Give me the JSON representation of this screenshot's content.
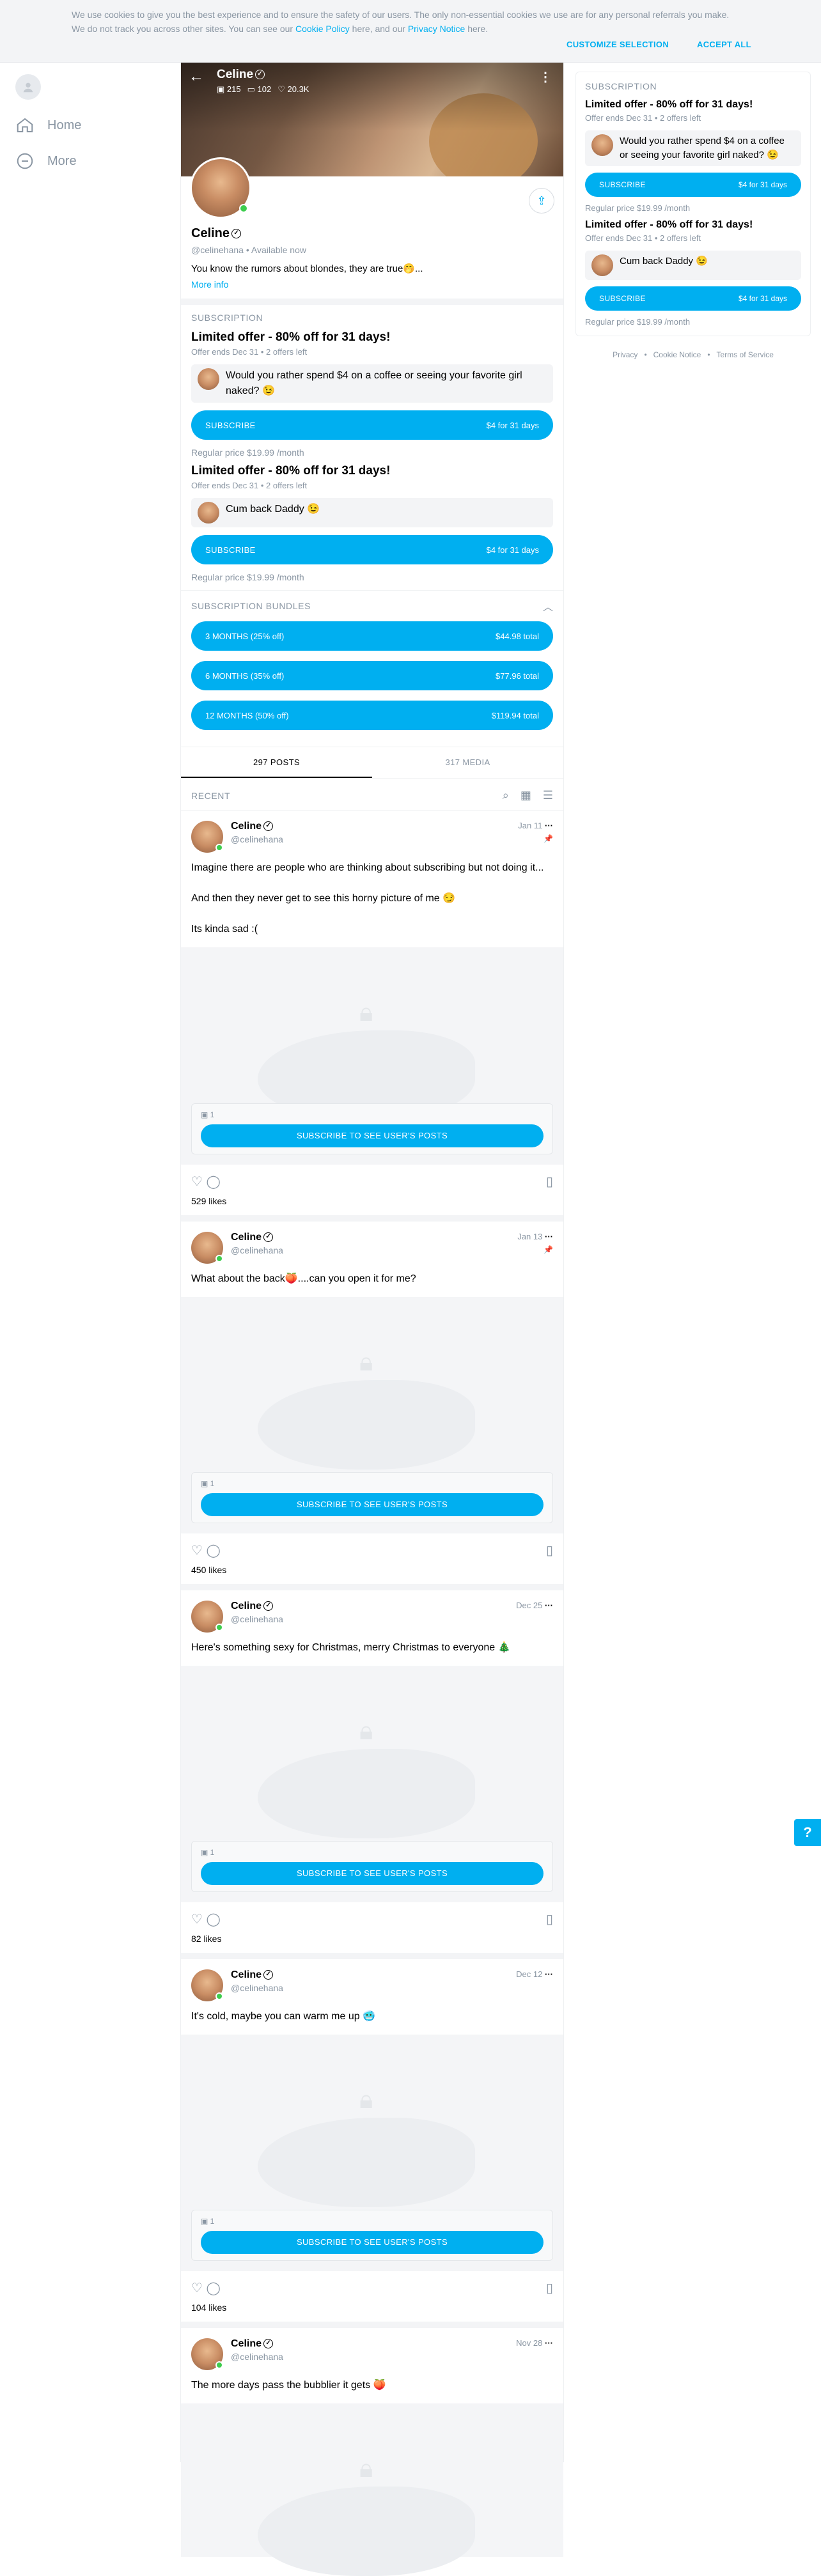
{
  "cookie": {
    "text_a": "We use cookies to give you the best experience and to ensure the safety of our users. The only non-essential cookies we use are for any personal referrals you make. We do not track you across other sites. You can see our ",
    "policy_link": "Cookie Policy",
    "text_b": " here, and our ",
    "privacy_link": "Privacy Notice",
    "text_c": " here.",
    "customize": "CUSTOMIZE SELECTION",
    "accept": "ACCEPT ALL"
  },
  "nav": {
    "home": "Home",
    "more": "More"
  },
  "profile": {
    "name": "Celine",
    "stats_photos": "215",
    "stats_videos": "102",
    "stats_likes": "20.3K",
    "handle": "@celinehana",
    "status": "Available now",
    "bio": "You know the rumors about blondes, they are true🤭...",
    "more_info": "More info"
  },
  "subscription": {
    "title": "SUBSCRIPTION",
    "offers": [
      {
        "title": "Limited offer - 80% off for 31 days!",
        "meta": "Offer ends Dec 31  •  2 offers left",
        "message": "Would you rather spend $4 on a coffee or seeing your favorite girl naked? 😉",
        "button_left": "SUBSCRIBE",
        "button_right": "$4 for 31 days",
        "regular": "Regular price $19.99 /month"
      },
      {
        "title": "Limited offer - 80% off for 31 days!",
        "meta": "Offer ends Dec 31  •  2 offers left",
        "message": "Cum back Daddy 😉",
        "button_left": "SUBSCRIBE",
        "button_right": "$4 for 31 days",
        "regular": "Regular price $19.99 /month"
      }
    ]
  },
  "bundles": {
    "title": "SUBSCRIPTION BUNDLES",
    "items": [
      {
        "label": "3 MONTHS (25% off)",
        "price": "$44.98 total"
      },
      {
        "label": "6 MONTHS (35% off)",
        "price": "$77.96 total"
      },
      {
        "label": "12 MONTHS (50% off)",
        "price": "$119.94 total"
      }
    ]
  },
  "tabs": {
    "posts": "297 POSTS",
    "media": "317 MEDIA"
  },
  "recent": "RECENT",
  "posts": [
    {
      "name": "Celine",
      "handle": "@celinehana",
      "date": "Jan 11",
      "text": "Imagine there are people who are thinking about subscribing but not doing it...\n\nAnd then they never get to see this horny picture of me 😏\n\nIts kinda sad :(",
      "media_count": "1",
      "cta": "SUBSCRIBE TO SEE USER'S POSTS",
      "likes": "529 likes"
    },
    {
      "name": "Celine",
      "handle": "@celinehana",
      "date": "Jan 13",
      "text": "What about the back🍑....can you open it for me?",
      "media_count": "1",
      "cta": "SUBSCRIBE TO SEE USER'S POSTS",
      "likes": "450 likes"
    },
    {
      "name": "Celine",
      "handle": "@celinehana",
      "date": "Dec 25",
      "text": "Here's something sexy for Christmas, merry Christmas to everyone 🎄",
      "media_count": "1",
      "cta": "SUBSCRIBE TO SEE USER'S POSTS",
      "likes": "82 likes"
    },
    {
      "name": "Celine",
      "handle": "@celinehana",
      "date": "Dec 12",
      "text": "It's cold, maybe you can warm me up 🥶",
      "media_count": "1",
      "cta": "SUBSCRIBE TO SEE USER'S POSTS",
      "likes": "104 likes"
    },
    {
      "name": "Celine",
      "handle": "@celinehana",
      "date": "Nov 28",
      "text": "The more days pass the bubblier it gets 🍑",
      "media_count": "",
      "cta": "",
      "likes": ""
    }
  ],
  "sidebar": {
    "title": "SUBSCRIPTION",
    "offers": [
      {
        "title": "Limited offer - 80% off for 31 days!",
        "meta": "Offer ends Dec 31  •  2 offers left",
        "message": "Would you rather spend $4 on a coffee or seeing your favorite girl naked? 😉",
        "button_left": "SUBSCRIBE",
        "button_right": "$4 for 31 days",
        "regular": "Regular price $19.99 /month"
      },
      {
        "title": "Limited offer - 80% off for 31 days!",
        "meta": "Offer ends Dec 31  •  2 offers left",
        "message": "Cum back Daddy 😉",
        "button_left": "SUBSCRIBE",
        "button_right": "$4 for 31 days",
        "regular": "Regular price $19.99 /month"
      }
    ]
  },
  "footer": {
    "privacy": "Privacy",
    "cookie": "Cookie Notice",
    "terms": "Terms of Service"
  },
  "help": "?"
}
